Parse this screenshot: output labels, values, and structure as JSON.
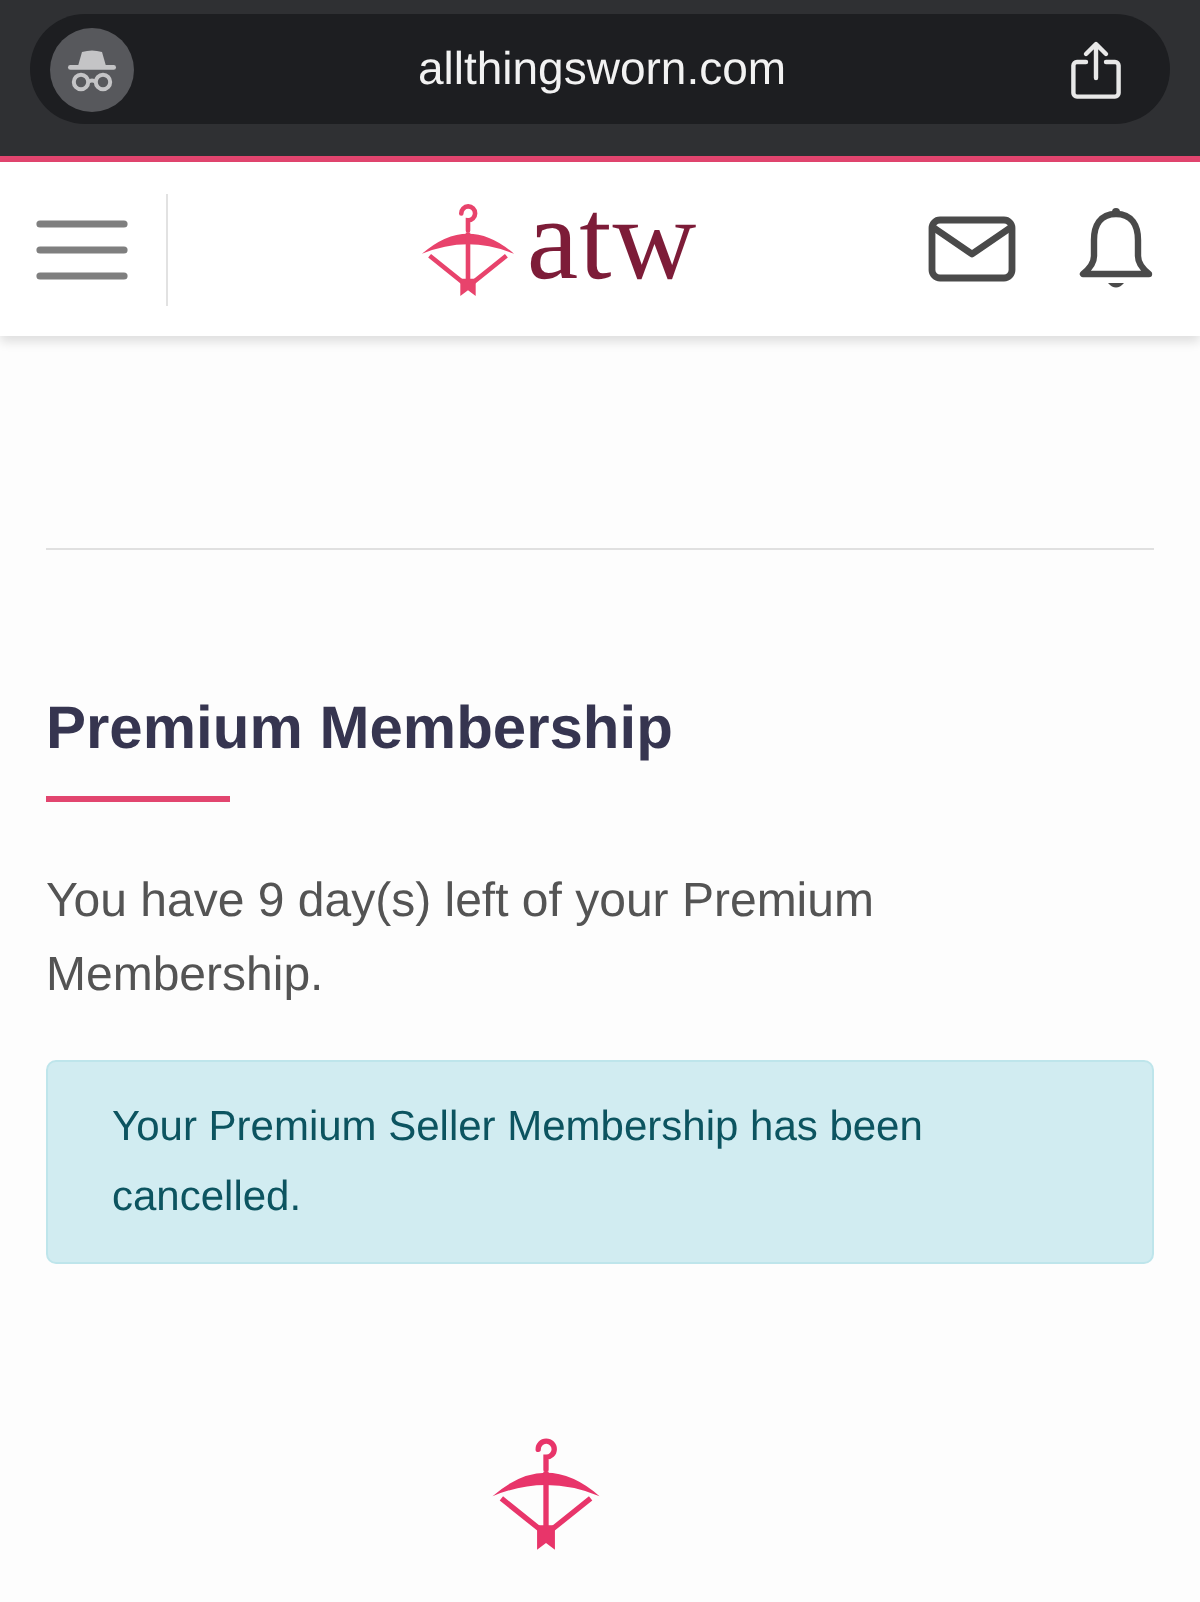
{
  "browser": {
    "url": "allthingsworn.com"
  },
  "header": {
    "logo_text": "atw"
  },
  "section": {
    "title": "Premium Membership",
    "text": "You have 9 day(s) left of your Premium Membership.",
    "alert": {
      "kind": "info",
      "text": "Your Premium Seller Membership has been cancelled."
    }
  }
}
